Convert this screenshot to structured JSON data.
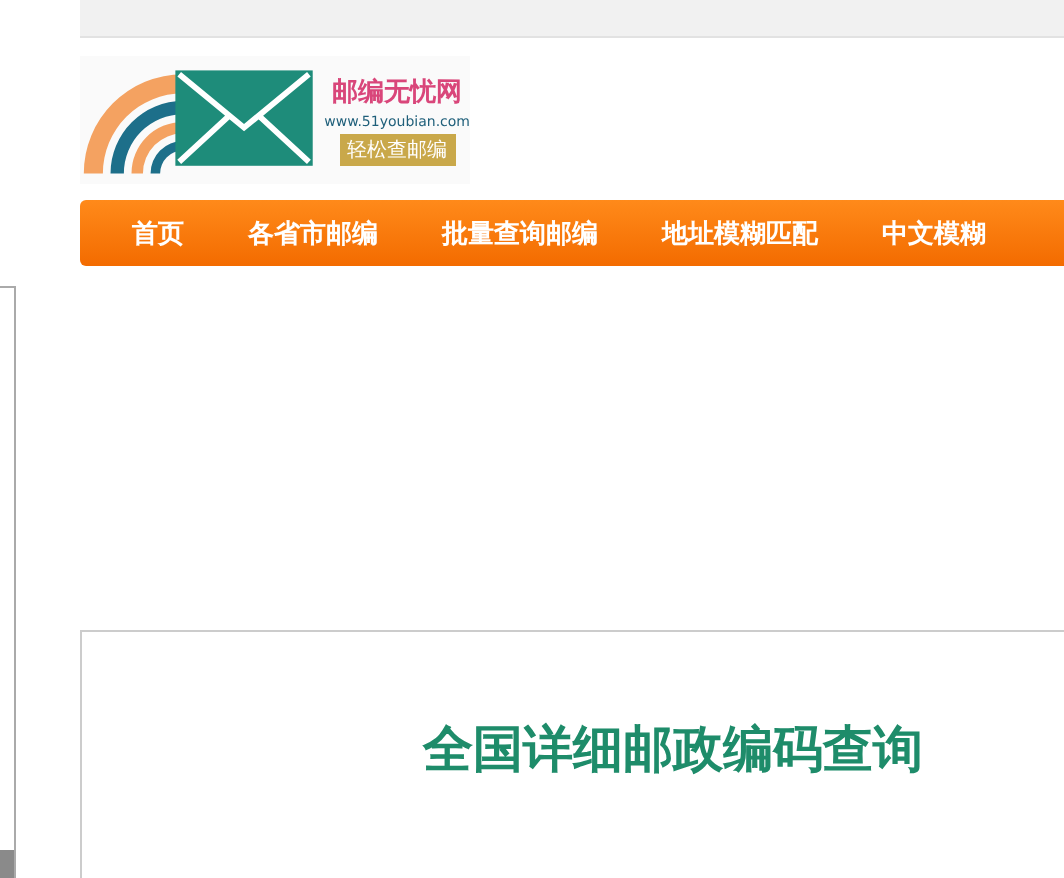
{
  "logo": {
    "name": "邮编无忧网",
    "url": "www.51youbian.com",
    "slogan": "轻松查邮编"
  },
  "nav": [
    {
      "label": "首页"
    },
    {
      "label": "各省市邮编"
    },
    {
      "label": "批量查询邮编"
    },
    {
      "label": "地址模糊匹配"
    },
    {
      "label": "中文模糊"
    }
  ],
  "main": {
    "title": "全国详细邮政编码查询"
  }
}
